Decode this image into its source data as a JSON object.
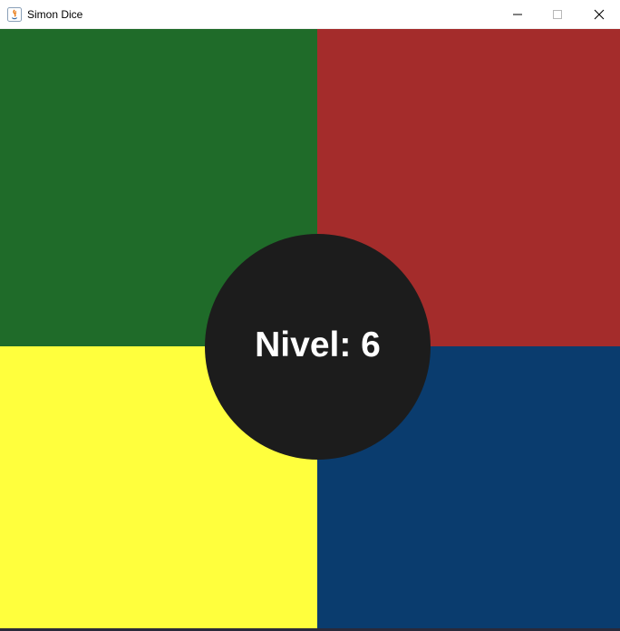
{
  "window": {
    "title": "Simon Dice",
    "app_icon": "java-app-icon",
    "controls": [
      "minimize-icon",
      "maximize-icon",
      "close-icon"
    ]
  },
  "board": {
    "quadrants": [
      {
        "name": "green",
        "color": "#1f6b29"
      },
      {
        "name": "red",
        "color": "#a42c2b"
      },
      {
        "name": "yellow",
        "color": "#ffff3d"
      },
      {
        "name": "blue",
        "color": "#0a3c6e"
      }
    ],
    "center_color": "#1c1c1c",
    "level_text": "Nivel: 6"
  }
}
